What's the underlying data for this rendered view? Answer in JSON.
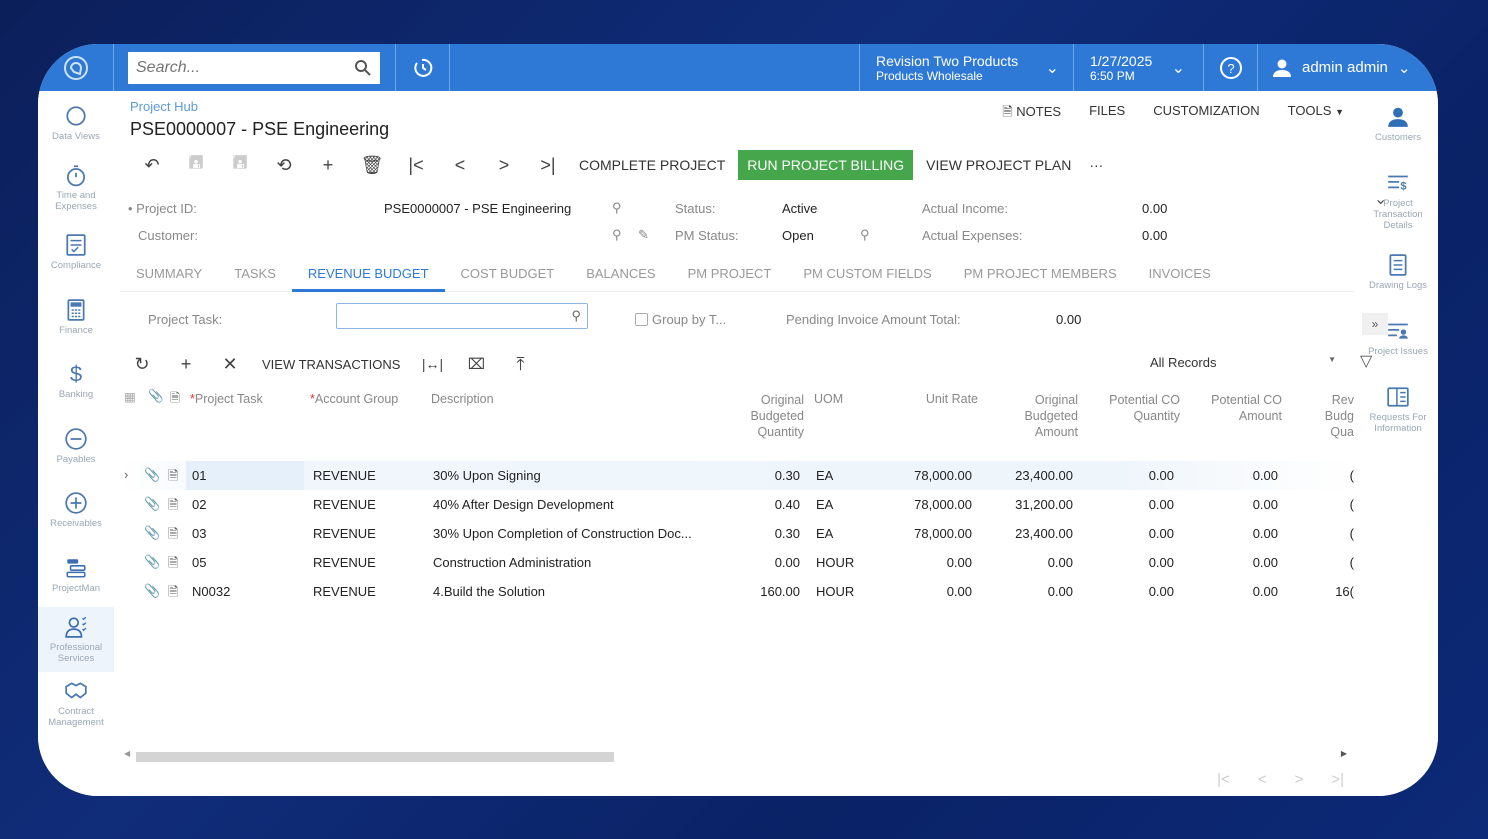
{
  "topbar": {
    "search_placeholder": "Search...",
    "company_line1": "Revision Two Products",
    "company_line2": "Products Wholesale",
    "date": "1/27/2025",
    "time": "6:50 PM",
    "user": "admin admin"
  },
  "left_nav": [
    {
      "label": "Data Views",
      "icon": "data-views-icon"
    },
    {
      "label": "Time and Expenses",
      "icon": "stopwatch-icon"
    },
    {
      "label": "Compliance",
      "icon": "compliance-icon"
    },
    {
      "label": "Finance",
      "icon": "calculator-icon"
    },
    {
      "label": "Banking",
      "icon": "dollar-icon"
    },
    {
      "label": "Payables",
      "icon": "minus-circle-icon"
    },
    {
      "label": "Receivables",
      "icon": "plus-circle-icon"
    },
    {
      "label": "ProjectMan",
      "icon": "projectman-icon"
    },
    {
      "label": "Professional Services",
      "icon": "professional-services-icon",
      "active": true
    },
    {
      "label": "Contract Management",
      "icon": "handshake-icon"
    }
  ],
  "right_nav": [
    {
      "label": "Customers",
      "icon": "person-icon"
    },
    {
      "label": "Project Transaction Details",
      "icon": "transaction-details-icon"
    },
    {
      "label": "Drawing Logs",
      "icon": "drawing-logs-icon"
    },
    {
      "label": "Project Issues",
      "icon": "project-issues-icon"
    },
    {
      "label": "Requests For Information",
      "icon": "rfi-icon"
    }
  ],
  "page": {
    "breadcrumb": "Project Hub",
    "title": "PSE0000007 - PSE Engineering",
    "links": {
      "notes": "NOTES",
      "files": "FILES",
      "customization": "CUSTOMIZATION",
      "tools": "TOOLS"
    },
    "actions": {
      "complete": "COMPLETE PROJECT",
      "billing": "RUN PROJECT BILLING",
      "plan": "VIEW PROJECT PLAN",
      "more": "···"
    }
  },
  "form": {
    "project_id_label": "Project ID:",
    "project_id_value": "PSE0000007 - PSE Engineering",
    "customer_label": "Customer:",
    "customer_value": "",
    "status_label": "Status:",
    "status_value": "Active",
    "pm_status_label": "PM Status:",
    "pm_status_value": "Open",
    "actual_income_label": "Actual Income:",
    "actual_income_value": "0.00",
    "actual_expenses_label": "Actual Expenses:",
    "actual_expenses_value": "0.00"
  },
  "tabs": [
    "SUMMARY",
    "TASKS",
    "REVENUE BUDGET",
    "COST BUDGET",
    "BALANCES",
    "PM PROJECT",
    "PM CUSTOM FIELDS",
    "PM PROJECT MEMBERS",
    "INVOICES"
  ],
  "active_tab": "REVENUE BUDGET",
  "filter": {
    "project_task_label": "Project Task:",
    "project_task_value": "",
    "group_by_label": "Group by T...",
    "group_by_checked": false,
    "pending_label": "Pending Invoice Amount Total:",
    "pending_value": "0.00"
  },
  "grid_toolbar": {
    "view_transactions": "VIEW TRANSACTIONS",
    "records_filter": "All Records"
  },
  "grid": {
    "columns": {
      "task": "Project Task",
      "account": "Account Group",
      "desc": "Description",
      "qty": "Original Budgeted Quantity",
      "uom": "UOM",
      "rate": "Unit Rate",
      "amount": "Original Budgeted Amount",
      "co_qty": "Potential CO Quantity",
      "co_amt": "Potential CO Amount",
      "rev": "Rev Budg Qua"
    },
    "rows": [
      {
        "task": "01",
        "account": "REVENUE",
        "desc": "30% Upon Signing",
        "qty": "0.30",
        "uom": "EA",
        "rate": "78,000.00",
        "amount": "23,400.00",
        "co_qty": "0.00",
        "co_amt": "0.00",
        "rev": "("
      },
      {
        "task": "02",
        "account": "REVENUE",
        "desc": "40% After Design Development",
        "qty": "0.40",
        "uom": "EA",
        "rate": "78,000.00",
        "amount": "31,200.00",
        "co_qty": "0.00",
        "co_amt": "0.00",
        "rev": "("
      },
      {
        "task": "03",
        "account": "REVENUE",
        "desc": "30% Upon Completion of Construction Doc...",
        "qty": "0.30",
        "uom": "EA",
        "rate": "78,000.00",
        "amount": "23,400.00",
        "co_qty": "0.00",
        "co_amt": "0.00",
        "rev": "("
      },
      {
        "task": "05",
        "account": "REVENUE",
        "desc": "Construction Administration",
        "qty": "0.00",
        "uom": "HOUR",
        "rate": "0.00",
        "amount": "0.00",
        "co_qty": "0.00",
        "co_amt": "0.00",
        "rev": "("
      },
      {
        "task": "N0032",
        "account": "REVENUE",
        "desc": "4.Build the Solution",
        "qty": "160.00",
        "uom": "HOUR",
        "rate": "0.00",
        "amount": "0.00",
        "co_qty": "0.00",
        "co_amt": "0.00",
        "rev": "16("
      }
    ]
  }
}
